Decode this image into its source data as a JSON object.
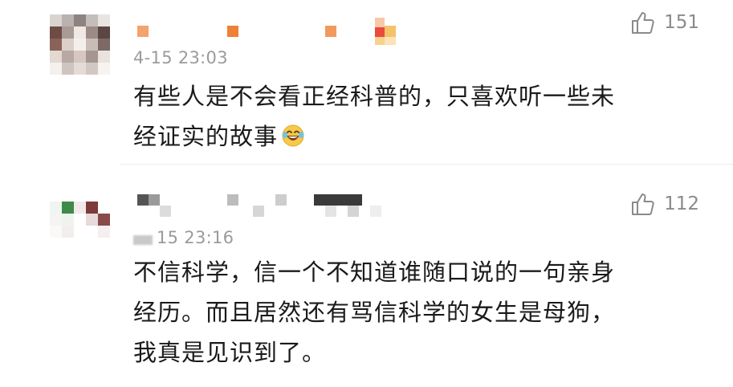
{
  "comments": [
    {
      "timestamp": "4-15 23:03",
      "lines": [
        "有些人是不会看正经科普的，只喜欢听一些未",
        "经证实的故事"
      ],
      "emoji": "laughing-with-tears-icon",
      "likes": "151"
    },
    {
      "timestamp": "15 23:16",
      "lines": [
        "不信科学，信一个不知道谁随口说的一句亲身",
        "经历。而且居然还有骂信科学的女生是母狗，",
        "我真是见识到了。"
      ],
      "likes": "112"
    }
  ],
  "colors": {
    "text": "#1a1a1a",
    "meta": "#9b9b9b",
    "icon": "#8a8a8a"
  }
}
